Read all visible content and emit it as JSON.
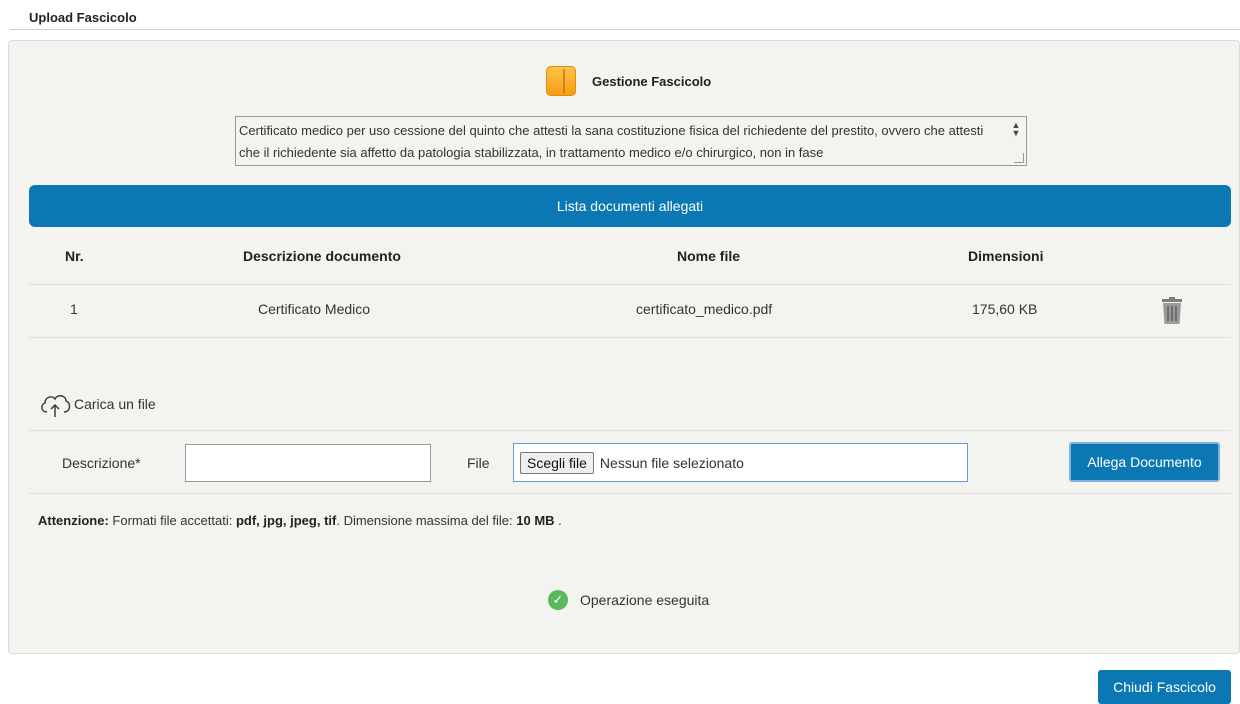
{
  "page": {
    "title": "Upload Fascicolo"
  },
  "gestione": {
    "title": "Gestione Fascicolo",
    "description": "Certificato medico per uso cessione del quinto che attesti la sana costituzione fisica del richiedente del prestito, ovvero che attesti che il richiedente sia affetto da patologia stabilizzata, in trattamento medico e/o chirurgico, non in fase"
  },
  "documents": {
    "header": "Lista documenti allegati",
    "columns": {
      "nr": "Nr.",
      "descrizione": "Descrizione documento",
      "nome": "Nome file",
      "dimensioni": "Dimensioni"
    },
    "rows": [
      {
        "nr": "1",
        "descrizione": "Certificato Medico",
        "nome": "certificato_medico.pdf",
        "dimensioni": "175,60 KB"
      }
    ]
  },
  "upload": {
    "title": "Carica un file",
    "descrizione_label": "Descrizione*",
    "descrizione_value": "",
    "file_label": "File",
    "choose_button": "Scegli file",
    "no_file": "Nessun file selezionato",
    "attach_button": "Allega Documento"
  },
  "note": {
    "prefix": "Attenzione:",
    "formats_text": "Formati file accettati:",
    "formats": "pdf, jpg, jpeg, tif",
    "size_text": ". Dimensione massima del file:",
    "max_size": "10 MB",
    "suffix": " ."
  },
  "status": {
    "message": "Operazione eseguita"
  },
  "footer": {
    "close_button": "Chiudi Fascicolo"
  },
  "colors": {
    "primary": "#0b78b4",
    "panel": "#f3f3ef",
    "success": "#5cb85c",
    "icon_folder": "#f4a623"
  }
}
